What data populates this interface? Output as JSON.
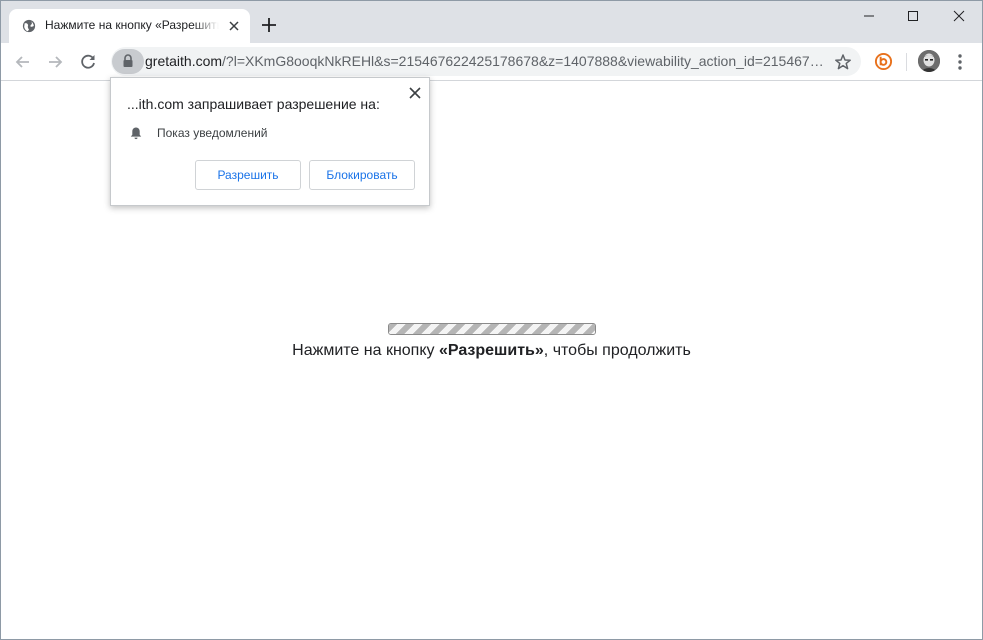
{
  "tab": {
    "title": "Нажмите на кнопку «Разрешить», чтобы продолжить"
  },
  "address_bar": {
    "host": "gretaith.com",
    "path": "/?l=XKmG8ooqkNkREHl&s=215467622425178678&z=1407888&viewability_action_id=215467…"
  },
  "permission_prompt": {
    "title": "...ith.com запрашивает разрешение на:",
    "permission": "Показ уведомлений",
    "allow_label": "Разрешить",
    "block_label": "Блокировать"
  },
  "page": {
    "progress_fraction": 1.0,
    "message_before": "Нажмите на кнопку ",
    "message_bold": "«Разрешить»",
    "message_after": ", чтобы продолжить"
  },
  "icons": {
    "tab_favicon": "globe-icon",
    "tab_close": "close-icon",
    "new_tab": "plus-icon",
    "back": "arrow-left-icon",
    "forward": "arrow-right-icon",
    "reload": "reload-icon",
    "lock": "lock-icon",
    "bookmark": "star-icon",
    "extension": "extension-icon",
    "menu": "kebab-menu-icon",
    "bell": "bell-icon"
  },
  "colors": {
    "tabstrip": "#dee1e6",
    "omnibox": "#f1f3f4",
    "accent_blue": "#1a73e8",
    "extension_orange": "#e8711c"
  }
}
